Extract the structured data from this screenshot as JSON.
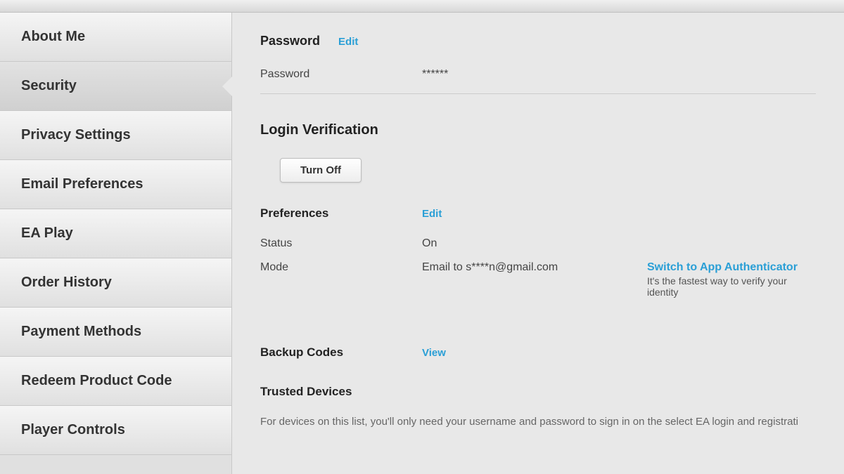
{
  "sidebar": {
    "items": [
      {
        "label": "About Me"
      },
      {
        "label": "Security"
      },
      {
        "label": "Privacy Settings"
      },
      {
        "label": "Email Preferences"
      },
      {
        "label": "EA Play"
      },
      {
        "label": "Order History"
      },
      {
        "label": "Payment Methods"
      },
      {
        "label": "Redeem Product Code"
      },
      {
        "label": "Player Controls"
      }
    ],
    "active_index": 1
  },
  "password_section": {
    "title": "Password",
    "edit_link": "Edit",
    "password_label": "Password",
    "password_value": "******"
  },
  "login_verification": {
    "title": "Login Verification",
    "turn_off_label": "Turn Off",
    "preferences_title": "Preferences",
    "preferences_edit": "Edit",
    "status_label": "Status",
    "status_value": "On",
    "mode_label": "Mode",
    "mode_value": "Email to s****n@gmail.com",
    "switch_link": "Switch to App Authenticator",
    "switch_sub": "It's the fastest way to verify your identity"
  },
  "backup_codes": {
    "title": "Backup Codes",
    "view_link": "View"
  },
  "trusted_devices": {
    "title": "Trusted Devices",
    "description": "For devices on this list, you'll only need your username and password to sign in on the select EA login and registrati"
  }
}
